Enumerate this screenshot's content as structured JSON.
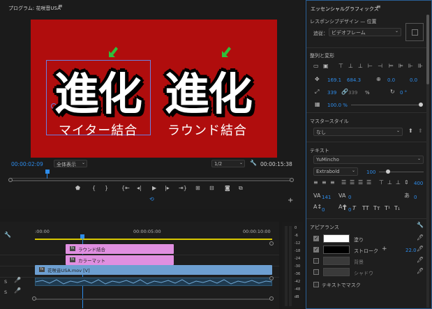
{
  "program": {
    "title": "プログラム: 花咲音USA",
    "menu_icon": "menu-icon",
    "title_big_left": "進化",
    "title_big_right": "進化",
    "sub_left": "マイター結合",
    "sub_right": "ラウンド結合",
    "timecode_current": "00:00:02:09",
    "fit_select": "全体表示",
    "quality_select": "1/2",
    "timecode_duration": "00:00:15:38",
    "canvas_color": "#b00d0d",
    "arrow_color": "#2fbf3a"
  },
  "timeline": {
    "ruler_labels": [
      ":00:00",
      "00:00:05:00",
      "00:00:10:00"
    ],
    "clips": {
      "round_join": "ラウンド結合",
      "color_matte": "カラーマット",
      "video": "花咲音USA.mov [V]"
    },
    "track_labels": [
      "S",
      "S"
    ],
    "clip_color_graphic": "#e08fe0",
    "clip_color_video": "#6d9fd1"
  },
  "meter": {
    "labels": [
      "0",
      "-6",
      "-12",
      "-18",
      "-24",
      "-30",
      "-36",
      "-42",
      "-48",
      "dB"
    ]
  },
  "essential": {
    "title": "エッセンシャルグラフィックス",
    "responsive_design": "レスポンシブデザイン — 位置",
    "follow_label": "追従：",
    "follow_value": "ビデオフレーム",
    "align_transform": "整列と変形",
    "pos_x": "169.1",
    "pos_y": "684.3",
    "anchor_x": "0.0",
    "anchor_y": "0.0",
    "scale_w": "339",
    "scale_h": "339",
    "scale_unit": "%",
    "rotation": "0 °",
    "opacity": "100.0 %",
    "master_style": "マスタースタイル",
    "master_style_value": "なし",
    "text_section": "テキスト",
    "font_name": "YuMincho",
    "font_style": "Extrabold",
    "font_size": "100",
    "tracking_value": "141",
    "kerning_value": "0",
    "leading_value": "0",
    "baseline_value": "0",
    "tsume_value": "0",
    "size_value": "400",
    "tt_buttons": [
      "T",
      "T",
      "TT",
      "Tт",
      "T¹",
      "T₁"
    ],
    "appearance": "アピアランス",
    "fill_label": "塗り",
    "fill_color": "#ffffff",
    "stroke_label": "ストローク",
    "stroke_color": "#000000",
    "stroke_width": "22.0",
    "background_label": "背景",
    "shadow_label": "シャドウ",
    "mask_label": "テキストでマスク"
  }
}
